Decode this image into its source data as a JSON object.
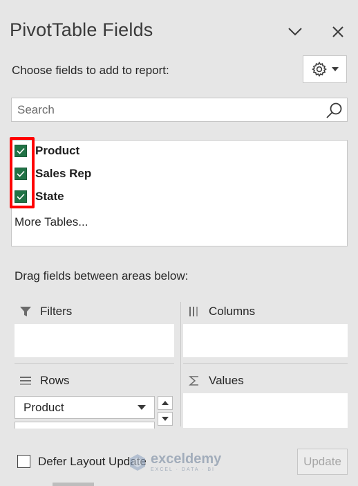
{
  "panel": {
    "title": "PivotTable Fields",
    "choose_label": "Choose fields to add to report:",
    "icons": {
      "collapse": "chevron-down-icon",
      "close": "close-icon",
      "settings": "gear-icon",
      "search": "search-icon"
    }
  },
  "search": {
    "placeholder": "Search",
    "value": ""
  },
  "fields": [
    {
      "label": "Product",
      "checked": true
    },
    {
      "label": "Sales Rep",
      "checked": true
    },
    {
      "label": "State",
      "checked": true
    }
  ],
  "more_tables_label": "More Tables...",
  "areas": {
    "drag_label": "Drag fields between areas below:",
    "filters": {
      "label": "Filters",
      "icon": "filter-icon"
    },
    "columns": {
      "label": "Columns",
      "icon": "columns-icon"
    },
    "rows": {
      "label": "Rows",
      "icon": "rows-icon",
      "items": [
        "Product"
      ]
    },
    "values": {
      "label": "Values",
      "icon": "sigma-icon"
    }
  },
  "footer": {
    "defer_label": "Defer Layout Update",
    "defer_checked": false,
    "update_label": "Update"
  },
  "watermark": {
    "brand": "exceldemy",
    "tagline": "EXCEL · DATA · BI"
  },
  "colors": {
    "accent": "#217346",
    "highlight": "#ff0000",
    "background": "#e6e6e6"
  }
}
